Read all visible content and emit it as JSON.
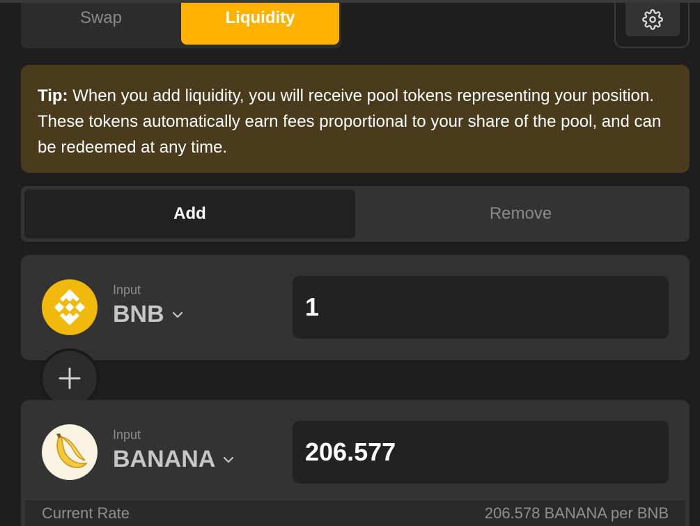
{
  "tabs": {
    "swap": "Swap",
    "liquidity": "Liquidity",
    "active": "Liquidity"
  },
  "tip": {
    "label": "Tip:",
    "text": "When you add liquidity, you will receive pool tokens representing your position. These tokens automatically earn fees proportional to your share of the pool, and can be redeemed at any time."
  },
  "mode": {
    "add": "Add",
    "remove": "Remove",
    "active": "Add"
  },
  "token_a": {
    "label": "Input",
    "symbol": "BNB",
    "icon": "bnb-icon",
    "amount": "1"
  },
  "token_b": {
    "label": "Input",
    "symbol": "BANANA",
    "icon": "banana-icon",
    "amount": "206.577"
  },
  "rate": {
    "label": "Current Rate",
    "value": "206.578 BANANA per BNB"
  },
  "colors": {
    "accent": "#ffb300",
    "tip_bg": "#4a3b1d",
    "bnb": "#f0b90b",
    "panel": "#333333"
  }
}
